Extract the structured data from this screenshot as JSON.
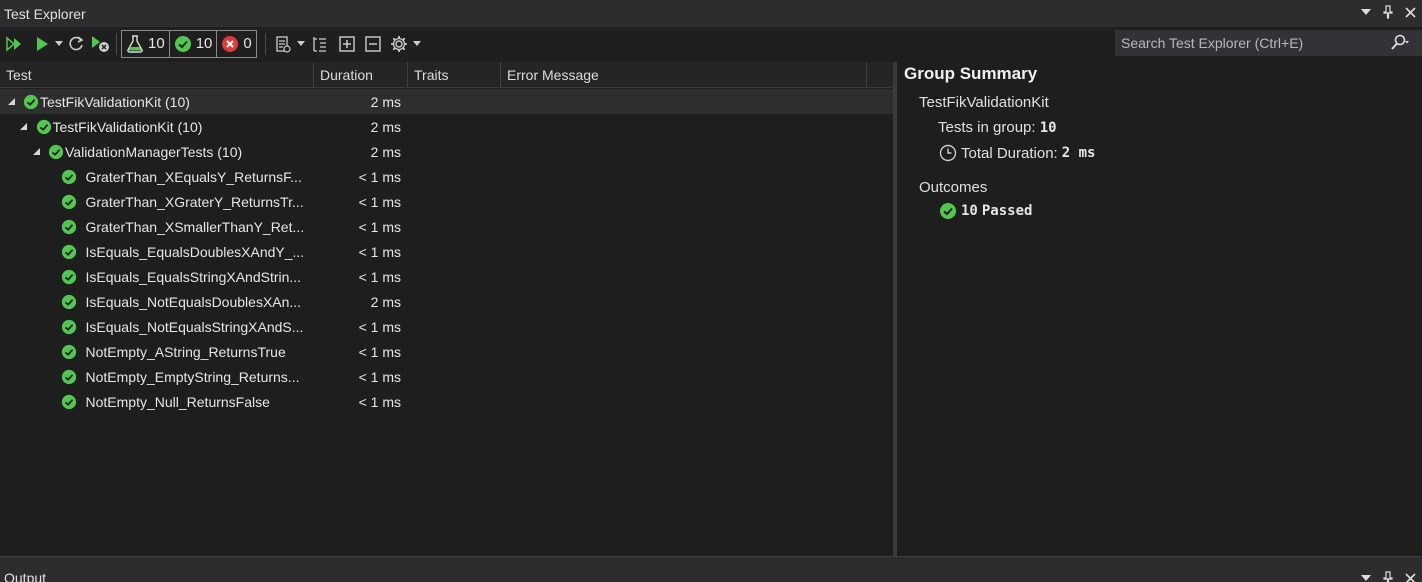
{
  "window": {
    "title": "Test Explorer",
    "controls": [
      "dropdown-icon",
      "pin-icon",
      "close-icon"
    ]
  },
  "toolbar": {
    "counters": [
      {
        "icon": "flask-icon",
        "value": "10"
      },
      {
        "icon": "passed-icon",
        "value": "10"
      },
      {
        "icon": "failed-icon",
        "value": "0"
      }
    ],
    "search_placeholder": "Search Test Explorer (Ctrl+E)"
  },
  "columns": {
    "test": "Test",
    "duration": "Duration",
    "traits": "Traits",
    "error": "Error Message"
  },
  "tree": [
    {
      "name": "TestFikValidationKit  (10)",
      "duration": "2 ms",
      "level": 0,
      "expandable": true,
      "selected": true
    },
    {
      "name": "TestFikValidationKit  (10)",
      "duration": "2 ms",
      "level": 1,
      "expandable": true
    },
    {
      "name": "ValidationManagerTests  (10)",
      "duration": "2 ms",
      "level": 2,
      "expandable": true
    },
    {
      "name": "GraterThan_XEqualsY_ReturnsF...",
      "duration": "< 1 ms",
      "level": 3
    },
    {
      "name": "GraterThan_XGraterY_ReturnsTr...",
      "duration": "< 1 ms",
      "level": 3
    },
    {
      "name": "GraterThan_XSmallerThanY_Ret...",
      "duration": "< 1 ms",
      "level": 3
    },
    {
      "name": "IsEquals_EqualsDoublesXAndY_...",
      "duration": "< 1 ms",
      "level": 3
    },
    {
      "name": "IsEquals_EqualsStringXAndStrin...",
      "duration": "< 1 ms",
      "level": 3
    },
    {
      "name": "IsEquals_NotEqualsDoublesXAn...",
      "duration": "2 ms",
      "level": 3
    },
    {
      "name": "IsEquals_NotEqualsStringXAndS...",
      "duration": "< 1 ms",
      "level": 3
    },
    {
      "name": "NotEmpty_AString_ReturnsTrue",
      "duration": "< 1 ms",
      "level": 3
    },
    {
      "name": "NotEmpty_EmptyString_Returns...",
      "duration": "< 1 ms",
      "level": 3
    },
    {
      "name": "NotEmpty_Null_ReturnsFalse",
      "duration": "< 1 ms",
      "level": 3
    }
  ],
  "summary": {
    "heading": "Group Summary",
    "group": "TestFikValidationKit",
    "tests_label": "Tests in group:",
    "tests_value": "10",
    "duration_label": "Total Duration:",
    "duration_value": "2 ms",
    "outcomes_label": "Outcomes",
    "passed_count": "10",
    "passed_label": "Passed"
  },
  "output": {
    "title": "Output"
  },
  "colors": {
    "passed": "#4ec94e",
    "failed": "#e03b3b",
    "background": "#1e1e1e"
  }
}
